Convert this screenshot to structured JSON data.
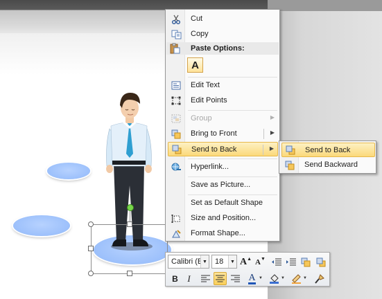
{
  "context_menu": {
    "cut": "Cut",
    "copy": "Copy",
    "paste_options": "Paste Options:",
    "paste_keep_text": "A",
    "edit_text": "Edit Text",
    "edit_points": "Edit Points",
    "group": "Group",
    "bring_to_front": "Bring to Front",
    "send_to_back": "Send to Back",
    "hyperlink": "Hyperlink...",
    "save_as_picture": "Save as Picture...",
    "set_default_shape": "Set as Default Shape",
    "size_and_position": "Size and Position...",
    "format_shape": "Format Shape..."
  },
  "submenu": {
    "send_to_back": "Send to Back",
    "send_backward": "Send Backward"
  },
  "mini_toolbar": {
    "font_name": "Calibri (E",
    "font_size": "18",
    "grow_font": "A",
    "shrink_font": "A",
    "bold": "B",
    "italic": "I",
    "font_color": "A"
  },
  "colors": {
    "highlight": "#fbd97a",
    "ellipse_fill": "#9cc0fb",
    "rotation_handle": "#78d64b"
  }
}
